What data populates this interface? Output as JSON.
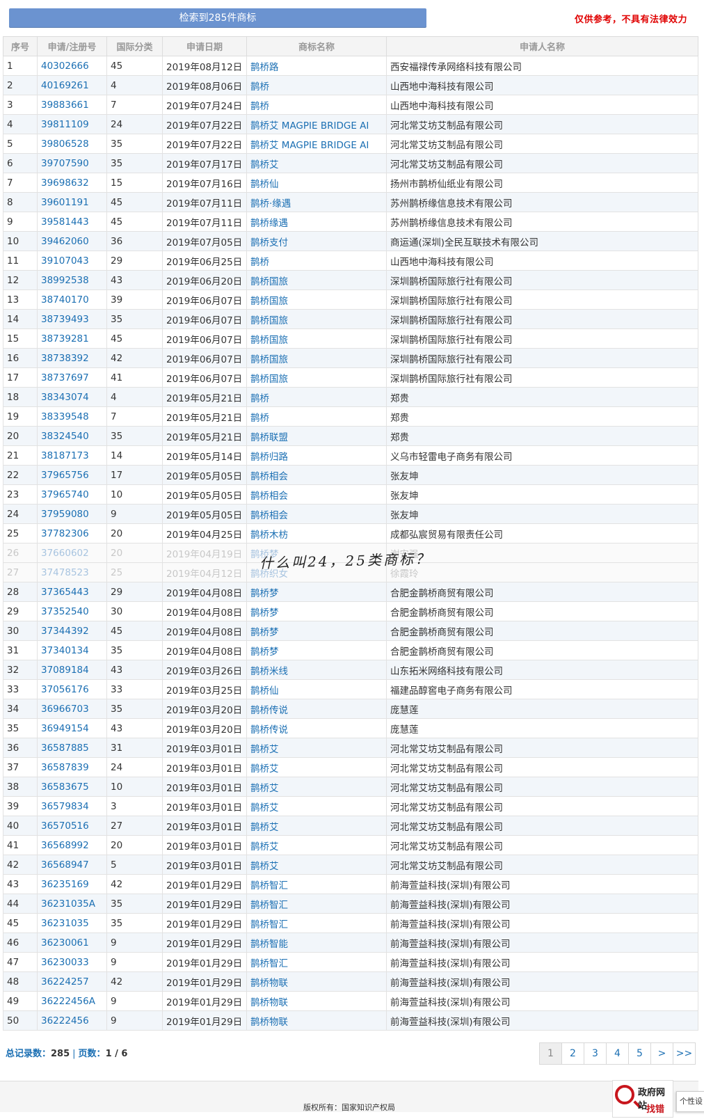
{
  "header": {
    "search_result_label": "检索到285件商标",
    "disclaimer": "仅供参考，不具有法律效力"
  },
  "table": {
    "columns": [
      "序号",
      "申请/注册号",
      "国际分类",
      "申请日期",
      "商标名称",
      "申请人名称"
    ],
    "rows": [
      [
        "1",
        "40302666",
        "45",
        "2019年08月12日",
        "鹊桥路",
        "西安福禄传承网络科技有限公司"
      ],
      [
        "2",
        "40169261",
        "4",
        "2019年08月06日",
        "鹊桥",
        "山西地中海科技有限公司"
      ],
      [
        "3",
        "39883661",
        "7",
        "2019年07月24日",
        "鹊桥",
        "山西地中海科技有限公司"
      ],
      [
        "4",
        "39811109",
        "24",
        "2019年07月22日",
        "鹊桥艾 MAGPIE BRIDGE AI",
        "河北常艾坊艾制品有限公司"
      ],
      [
        "5",
        "39806528",
        "35",
        "2019年07月22日",
        "鹊桥艾 MAGPIE BRIDGE AI",
        "河北常艾坊艾制品有限公司"
      ],
      [
        "6",
        "39707590",
        "35",
        "2019年07月17日",
        "鹊桥艾",
        "河北常艾坊艾制品有限公司"
      ],
      [
        "7",
        "39698632",
        "15",
        "2019年07月16日",
        "鹊桥仙",
        "扬州市鹊桥仙纸业有限公司"
      ],
      [
        "8",
        "39601191",
        "45",
        "2019年07月11日",
        "鹊桥·缘遇",
        "苏州鹊桥缘信息技术有限公司"
      ],
      [
        "9",
        "39581443",
        "45",
        "2019年07月11日",
        "鹊桥缘遇",
        "苏州鹊桥缘信息技术有限公司"
      ],
      [
        "10",
        "39462060",
        "36",
        "2019年07月05日",
        "鹊桥支付",
        "商运通(深圳)全民互联技术有限公司"
      ],
      [
        "11",
        "39107043",
        "29",
        "2019年06月25日",
        "鹊桥",
        "山西地中海科技有限公司"
      ],
      [
        "12",
        "38992538",
        "43",
        "2019年06月20日",
        "鹊桥国旅",
        "深圳鹊桥国际旅行社有限公司"
      ],
      [
        "13",
        "38740170",
        "39",
        "2019年06月07日",
        "鹊桥国旅",
        "深圳鹊桥国际旅行社有限公司"
      ],
      [
        "14",
        "38739493",
        "35",
        "2019年06月07日",
        "鹊桥国旅",
        "深圳鹊桥国际旅行社有限公司"
      ],
      [
        "15",
        "38739281",
        "45",
        "2019年06月07日",
        "鹊桥国旅",
        "深圳鹊桥国际旅行社有限公司"
      ],
      [
        "16",
        "38738392",
        "42",
        "2019年06月07日",
        "鹊桥国旅",
        "深圳鹊桥国际旅行社有限公司"
      ],
      [
        "17",
        "38737697",
        "41",
        "2019年06月07日",
        "鹊桥国旅",
        "深圳鹊桥国际旅行社有限公司"
      ],
      [
        "18",
        "38343074",
        "4",
        "2019年05月21日",
        "鹊桥",
        "郑贵"
      ],
      [
        "19",
        "38339548",
        "7",
        "2019年05月21日",
        "鹊桥",
        "郑贵"
      ],
      [
        "20",
        "38324540",
        "35",
        "2019年05月21日",
        "鹊桥联盟",
        "郑贵"
      ],
      [
        "21",
        "38187173",
        "14",
        "2019年05月14日",
        "鹊桥归路",
        "义乌市轻雷电子商务有限公司"
      ],
      [
        "22",
        "37965756",
        "17",
        "2019年05月05日",
        "鹊桥相会",
        "张友坤"
      ],
      [
        "23",
        "37965740",
        "10",
        "2019年05月05日",
        "鹊桥相会",
        "张友坤"
      ],
      [
        "24",
        "37959080",
        "9",
        "2019年05月05日",
        "鹊桥相会",
        "张友坤"
      ],
      [
        "25",
        "37782306",
        "20",
        "2019年04月25日",
        "鹊桥木枋",
        "成都弘宸贸易有限责任公司"
      ],
      [
        "26",
        "37660602",
        "20",
        "2019年04月19日",
        "鹊桥梦",
        "谢安强"
      ],
      [
        "27",
        "37478523",
        "25",
        "2019年04月12日",
        "鹊桥织女",
        "徐霞玲"
      ],
      [
        "28",
        "37365443",
        "29",
        "2019年04月08日",
        "鹊桥梦",
        "合肥金鹊桥商贸有限公司"
      ],
      [
        "29",
        "37352540",
        "30",
        "2019年04月08日",
        "鹊桥梦",
        "合肥金鹊桥商贸有限公司"
      ],
      [
        "30",
        "37344392",
        "45",
        "2019年04月08日",
        "鹊桥梦",
        "合肥金鹊桥商贸有限公司"
      ],
      [
        "31",
        "37340134",
        "35",
        "2019年04月08日",
        "鹊桥梦",
        "合肥金鹊桥商贸有限公司"
      ],
      [
        "32",
        "37089184",
        "43",
        "2019年03月26日",
        "鹊桥米线",
        "山东拓米网络科技有限公司"
      ],
      [
        "33",
        "37056176",
        "33",
        "2019年03月25日",
        "鹊桥仙",
        "福建品醇窖电子商务有限公司"
      ],
      [
        "34",
        "36966703",
        "35",
        "2019年03月20日",
        "鹊桥传说",
        "庞慧莲"
      ],
      [
        "35",
        "36949154",
        "43",
        "2019年03月20日",
        "鹊桥传说",
        "庞慧莲"
      ],
      [
        "36",
        "36587885",
        "31",
        "2019年03月01日",
        "鹊桥艾",
        "河北常艾坊艾制品有限公司"
      ],
      [
        "37",
        "36587839",
        "24",
        "2019年03月01日",
        "鹊桥艾",
        "河北常艾坊艾制品有限公司"
      ],
      [
        "38",
        "36583675",
        "10",
        "2019年03月01日",
        "鹊桥艾",
        "河北常艾坊艾制品有限公司"
      ],
      [
        "39",
        "36579834",
        "3",
        "2019年03月01日",
        "鹊桥艾",
        "河北常艾坊艾制品有限公司"
      ],
      [
        "40",
        "36570516",
        "27",
        "2019年03月01日",
        "鹊桥艾",
        "河北常艾坊艾制品有限公司"
      ],
      [
        "41",
        "36568992",
        "20",
        "2019年03月01日",
        "鹊桥艾",
        "河北常艾坊艾制品有限公司"
      ],
      [
        "42",
        "36568947",
        "5",
        "2019年03月01日",
        "鹊桥艾",
        "河北常艾坊艾制品有限公司"
      ],
      [
        "43",
        "36235169",
        "42",
        "2019年01月29日",
        "鹊桥智汇",
        "前海萱益科技(深圳)有限公司"
      ],
      [
        "44",
        "36231035A",
        "35",
        "2019年01月29日",
        "鹊桥智汇",
        "前海萱益科技(深圳)有限公司"
      ],
      [
        "45",
        "36231035",
        "35",
        "2019年01月29日",
        "鹊桥智汇",
        "前海萱益科技(深圳)有限公司"
      ],
      [
        "46",
        "36230061",
        "9",
        "2019年01月29日",
        "鹊桥智能",
        "前海萱益科技(深圳)有限公司"
      ],
      [
        "47",
        "36230033",
        "9",
        "2019年01月29日",
        "鹊桥智汇",
        "前海萱益科技(深圳)有限公司"
      ],
      [
        "48",
        "36224257",
        "42",
        "2019年01月29日",
        "鹊桥物联",
        "前海萱益科技(深圳)有限公司"
      ],
      [
        "49",
        "36222456A",
        "9",
        "2019年01月29日",
        "鹊桥物联",
        "前海萱益科技(深圳)有限公司"
      ],
      [
        "50",
        "36222456",
        "9",
        "2019年01月29日",
        "鹊桥物联",
        "前海萱益科技(深圳)有限公司"
      ]
    ]
  },
  "annotation": "什么叫24，25类商标？",
  "footer": {
    "total_label": "总记录数：",
    "total_value": "285",
    "separator": "|",
    "pages_label": "页数：",
    "pages_value": "1 / 6",
    "pager": [
      "1",
      "2",
      "3",
      "4",
      "5",
      ">",
      ">>"
    ],
    "copyright": "版权所有：国家知识产权局",
    "gov_badge_line1": "政府网站",
    "gov_badge_line2": "找错",
    "personalize": "个性设"
  },
  "colors": {
    "banner": "#6b93d0",
    "link": "#1b6fb3",
    "disclaimer": "#e00000"
  }
}
